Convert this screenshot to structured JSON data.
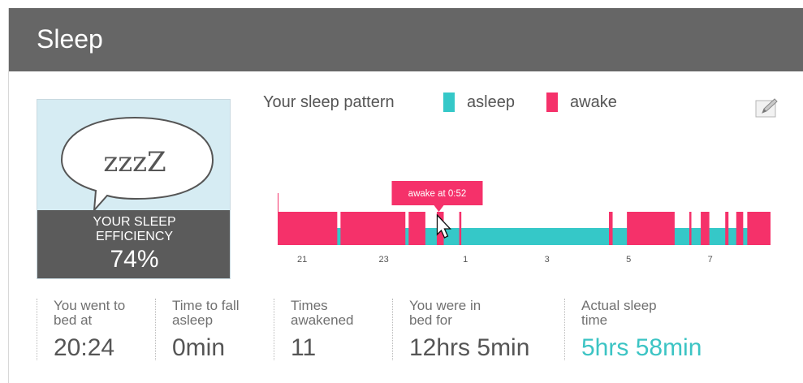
{
  "header": {
    "title": "Sleep"
  },
  "efficiency": {
    "bubble_text": "zzzZ",
    "label": "YOUR SLEEP\nEFFICIENCY",
    "label_line1": "YOUR SLEEP",
    "label_line2": "EFFICIENCY",
    "value": "74%",
    "value_fraction": 0.74
  },
  "legend": {
    "title": "Your sleep pattern",
    "asleep_label": "asleep",
    "awake_label": "awake",
    "asleep_color": "#35c8c8",
    "awake_color": "#f5316a"
  },
  "edit_icon": "edit-icon",
  "tooltip": {
    "text": "awake at 0:52"
  },
  "chart_data": {
    "type": "timeline",
    "x_start_hour": 20.4,
    "x_end_hour": 32.48,
    "tick_labels": [
      {
        "label": "21",
        "hour": 21
      },
      {
        "label": "23",
        "hour": 23
      },
      {
        "label": "1",
        "hour": 25
      },
      {
        "label": "3",
        "hour": 27
      },
      {
        "label": "5",
        "hour": 29
      },
      {
        "label": "7",
        "hour": 31
      }
    ],
    "asleep_span": [
      20.4,
      32.48
    ],
    "awake_periods": [
      [
        20.4,
        21.86
      ],
      [
        21.94,
        23.53
      ],
      [
        23.61,
        24.02
      ],
      [
        24.3,
        24.47
      ],
      [
        24.85,
        24.9
      ],
      [
        28.52,
        28.61
      ],
      [
        28.96,
        30.13
      ],
      [
        30.49,
        30.54
      ],
      [
        30.77,
        30.98
      ],
      [
        31.37,
        31.45
      ],
      [
        31.64,
        31.81
      ],
      [
        31.91,
        32.48
      ]
    ]
  },
  "stats": [
    {
      "label": "You went to\nbed at",
      "value": "20:24",
      "accent": false
    },
    {
      "label": "Time to fall\nasleep",
      "value": "0min",
      "accent": false
    },
    {
      "label": "Times\nawakened",
      "value": "11",
      "accent": false
    },
    {
      "label": "You were in\nbed for",
      "value": "12hrs 5min",
      "accent": false
    },
    {
      "label": "Actual sleep\ntime",
      "value": "5hrs 58min",
      "accent": true
    }
  ]
}
